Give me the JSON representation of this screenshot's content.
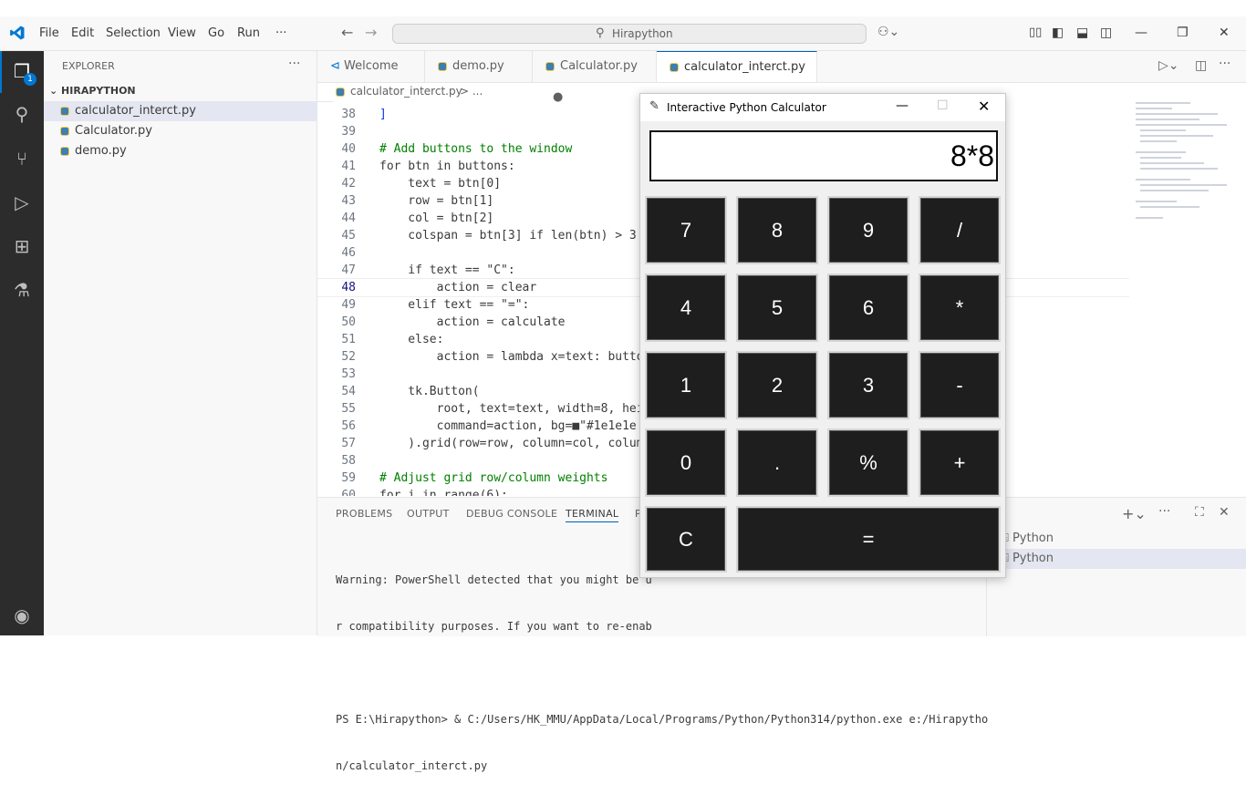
{
  "titlebar": {
    "menus": [
      "File",
      "Edit",
      "Selection",
      "View",
      "Go",
      "Run",
      "···"
    ],
    "search_text": "Hirapython"
  },
  "activity": {
    "badge": "1"
  },
  "explorer": {
    "header": "EXPLORER",
    "folder": "HIRAPYTHON",
    "files": [
      "calculator_interct.py",
      "Calculator.py",
      "demo.py"
    ]
  },
  "tabs": [
    "Welcome",
    "demo.py",
    "Calculator.py",
    "calculator_interct.py"
  ],
  "breadcrumb": {
    "file": "calculator_interct.py",
    "rest": "> ..."
  },
  "editor": {
    "line_numbers": [
      "38",
      "39",
      "40",
      "41",
      "42",
      "43",
      "44",
      "45",
      "46",
      "47",
      "48",
      "49",
      "50",
      "51",
      "52",
      "53",
      "54",
      "55",
      "56",
      "57",
      "58",
      "59",
      "60"
    ],
    "lines": [
      "]",
      "",
      "# Add buttons to the window",
      "for btn in buttons:",
      "    text = btn[0]",
      "    row = btn[1]",
      "    col = btn[2]",
      "    colspan = btn[3] if len(btn) > 3",
      "",
      "    if text == \"C\":",
      "        action = clear",
      "    elif text == \"=\":",
      "        action = calculate",
      "    else:",
      "        action = lambda x=text: butto",
      "",
      "    tk.Button(",
      "        root, text=text, width=8, hei",
      "        command=action, bg=■\"#1e1e1e",
      "    ).grid(row=row, column=col, colum",
      "",
      "# Adjust grid row/column weights",
      "for i in range(6):"
    ]
  },
  "panel": {
    "tabs": [
      "PROBLEMS",
      "OUTPUT",
      "DEBUG CONSOLE",
      "TERMINAL",
      "P"
    ],
    "terminal_lines": [
      "Warning: PowerShell detected that you might be u",
      "r compatibility purposes. If you want to re-enab",
      "",
      "PS E:\\Hirapython> & C:/Users/HK_MMU/AppData/Local/Programs/Python/Python314/python.exe e:/Hirapytho",
      "n/calculator_interct.py"
    ],
    "terminals": [
      "Python",
      "Python"
    ]
  },
  "calculator": {
    "title": "Interactive Python Calculator",
    "display": "8*8",
    "buttons": [
      "7",
      "8",
      "9",
      "/",
      "4",
      "5",
      "6",
      "*",
      "1",
      "2",
      "3",
      "-",
      "0",
      ".",
      "%",
      "+",
      "C",
      "="
    ]
  },
  "colors": {
    "accent": "#005fb8",
    "calc_button_bg": "#1e1e1e",
    "activity_bg": "#2c2c2c"
  }
}
